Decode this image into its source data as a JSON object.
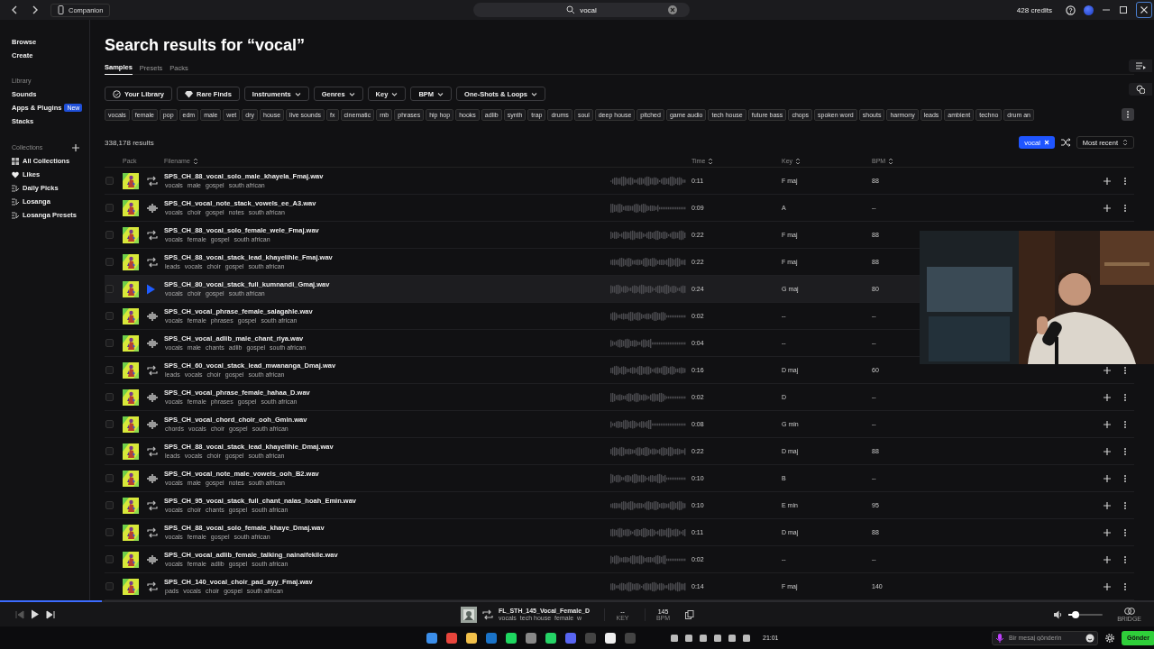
{
  "title_bar": {
    "companion": "Companion",
    "search": {
      "value": "vocal"
    },
    "credits": "428 credits"
  },
  "sidebar": {
    "top_items": [
      {
        "label": "Browse",
        "selected": false
      },
      {
        "label": "Create",
        "selected": false
      }
    ],
    "library": {
      "title": "Library",
      "items": [
        {
          "label": "Sounds"
        },
        {
          "label": "Apps & Plugins",
          "badge": "New"
        },
        {
          "label": "Stacks"
        }
      ]
    },
    "collections": {
      "title": "Collections",
      "items": [
        {
          "label": "All Collections",
          "kind": "grid"
        },
        {
          "label": "Likes",
          "kind": "heart"
        },
        {
          "label": "Daily Picks",
          "kind": "stack"
        },
        {
          "label": "Losanga",
          "kind": "stack"
        },
        {
          "label": "Losanga Presets",
          "kind": "stack"
        }
      ]
    }
  },
  "heading": "Search results for “vocal”",
  "tabs": [
    {
      "label": "Samples",
      "selected": true
    },
    {
      "label": "Presets",
      "selected": false
    },
    {
      "label": "Packs",
      "selected": false
    }
  ],
  "filters": [
    {
      "label": "Your Library",
      "kind": "check"
    },
    {
      "label": "Rare Finds",
      "kind": "diamond"
    },
    {
      "label": "Instruments",
      "kind": "dropdown"
    },
    {
      "label": "Genres",
      "kind": "dropdown"
    },
    {
      "label": "Key",
      "kind": "dropdown"
    },
    {
      "label": "BPM",
      "kind": "dropdown"
    },
    {
      "label": "One-Shots & Loops",
      "kind": "dropdown"
    }
  ],
  "tags": [
    "vocals",
    "female",
    "pop",
    "edm",
    "male",
    "wet",
    "dry",
    "house",
    "live sounds",
    "fx",
    "cinematic",
    "rnb",
    "phrases",
    "hip hop",
    "hooks",
    "adlib",
    "synth",
    "trap",
    "drums",
    "soul",
    "deep house",
    "pitched",
    "game audio",
    "tech house",
    "future bass",
    "chops",
    "spoken word",
    "shouts",
    "harmony",
    "leads",
    "ambient",
    "techno",
    "drum an"
  ],
  "results_count": "338,178 results",
  "active_filter": "vocal",
  "sort": "Most recent",
  "columns": [
    {
      "label": "Pack",
      "sortable": false
    },
    {
      "label": "Filename",
      "sortable": true
    },
    {
      "label": "Time",
      "sortable": true
    },
    {
      "label": "Key",
      "sortable": true
    },
    {
      "label": "BPM",
      "sortable": true
    }
  ],
  "rows": [
    {
      "name": "SPS_CH_88_vocal_solo_male_khayela_Fmaj.wav",
      "tags": [
        "vocals",
        "male",
        "gospel",
        "south african"
      ],
      "time": "0:11",
      "key": "F maj",
      "bpm": "88",
      "kind": "loop",
      "checked": false,
      "playing": false,
      "covered": false
    },
    {
      "name": "SPS_CH_vocal_note_stack_vowels_ee_A3.wav",
      "tags": [
        "vocals",
        "choir",
        "gospel",
        "notes",
        "south african"
      ],
      "time": "0:09",
      "key": "A",
      "bpm": "--",
      "kind": "oneshot",
      "checked": false,
      "playing": false,
      "covered": false
    },
    {
      "name": "SPS_CH_88_vocal_solo_female_wele_Fmaj.wav",
      "tags": [
        "vocals",
        "female",
        "gospel",
        "south african"
      ],
      "time": "0:22",
      "key": "F maj",
      "bpm": "88",
      "kind": "loop",
      "checked": false,
      "playing": false,
      "covered": true
    },
    {
      "name": "SPS_CH_88_vocal_stack_lead_khayelihle_Fmaj.wav",
      "tags": [
        "leads",
        "vocals",
        "choir",
        "gospel",
        "south african"
      ],
      "time": "0:22",
      "key": "F maj",
      "bpm": "88",
      "kind": "loop",
      "checked": false,
      "playing": false,
      "covered": true
    },
    {
      "name": "SPS_CH_80_vocal_stack_full_kumnandi_Gmaj.wav",
      "tags": [
        "vocals",
        "choir",
        "gospel",
        "south african"
      ],
      "time": "0:24",
      "key": "G maj",
      "bpm": "80",
      "kind": "loop",
      "checked": false,
      "playing": true,
      "covered": true
    },
    {
      "name": "SPS_CH_vocal_phrase_female_salagahle.wav",
      "tags": [
        "vocals",
        "female",
        "phrases",
        "gospel",
        "south african"
      ],
      "time": "0:02",
      "key": "--",
      "bpm": "--",
      "kind": "oneshot",
      "checked": false,
      "playing": false,
      "covered": true
    },
    {
      "name": "SPS_CH_vocal_adlib_male_chant_riya.wav",
      "tags": [
        "vocals",
        "male",
        "chants",
        "adlib",
        "gospel",
        "south african"
      ],
      "time": "0:04",
      "key": "--",
      "bpm": "--",
      "kind": "oneshot",
      "checked": false,
      "playing": false,
      "covered": true
    },
    {
      "name": "SPS_CH_60_vocal_stack_lead_mwananga_Dmaj.wav",
      "tags": [
        "leads",
        "vocals",
        "choir",
        "gospel",
        "south african"
      ],
      "time": "0:16",
      "key": "D maj",
      "bpm": "60",
      "kind": "loop",
      "checked": false,
      "playing": false,
      "covered": false
    },
    {
      "name": "SPS_CH_vocal_phrase_female_hahaa_D.wav",
      "tags": [
        "vocals",
        "female",
        "phrases",
        "gospel",
        "south african"
      ],
      "time": "0:02",
      "key": "D",
      "bpm": "--",
      "kind": "oneshot",
      "checked": false,
      "playing": false,
      "covered": false
    },
    {
      "name": "SPS_CH_vocal_chord_choir_ooh_Gmin.wav",
      "tags": [
        "chords",
        "vocals",
        "choir",
        "gospel",
        "south african"
      ],
      "time": "0:08",
      "key": "G min",
      "bpm": "--",
      "kind": "oneshot",
      "checked": false,
      "playing": false,
      "covered": false
    },
    {
      "name": "SPS_CH_88_vocal_stack_lead_khayelihle_Dmaj.wav",
      "tags": [
        "leads",
        "vocals",
        "choir",
        "gospel",
        "south african"
      ],
      "time": "0:22",
      "key": "D maj",
      "bpm": "88",
      "kind": "loop",
      "checked": false,
      "playing": false,
      "covered": false
    },
    {
      "name": "SPS_CH_vocal_note_male_vowels_ooh_B2.wav",
      "tags": [
        "vocals",
        "male",
        "gospel",
        "notes",
        "south african"
      ],
      "time": "0:10",
      "key": "B",
      "bpm": "--",
      "kind": "oneshot",
      "checked": false,
      "playing": false,
      "covered": false
    },
    {
      "name": "SPS_CH_95_vocal_stack_full_chant_nalas_hoah_Emin.wav",
      "tags": [
        "vocals",
        "choir",
        "chants",
        "gospel",
        "south african"
      ],
      "time": "0:10",
      "key": "E min",
      "bpm": "95",
      "kind": "loop",
      "checked": false,
      "playing": false,
      "covered": false
    },
    {
      "name": "SPS_CH_88_vocal_solo_female_khaye_Dmaj.wav",
      "tags": [
        "vocals",
        "female",
        "gospel",
        "south african"
      ],
      "time": "0:11",
      "key": "D maj",
      "bpm": "88",
      "kind": "loop",
      "checked": false,
      "playing": false,
      "covered": false
    },
    {
      "name": "SPS_CH_vocal_adlib_female_talking_nainaifekile.wav",
      "tags": [
        "vocals",
        "female",
        "adlib",
        "gospel",
        "south african"
      ],
      "time": "0:02",
      "key": "--",
      "bpm": "--",
      "kind": "oneshot",
      "checked": false,
      "playing": false,
      "covered": false
    },
    {
      "name": "SPS_CH_140_vocal_choir_pad_ayy_Fmaj.wav",
      "tags": [
        "pads",
        "vocals",
        "choir",
        "gospel",
        "south african"
      ],
      "time": "0:14",
      "key": "F maj",
      "bpm": "140",
      "kind": "loop",
      "checked": false,
      "playing": false,
      "covered": false
    }
  ],
  "player": {
    "progress": {
      "level": 0.088
    },
    "title": "FL_STH_145_Vocal_Female_D",
    "tags": [
      "vocals",
      "tech house",
      "female",
      "w"
    ],
    "key": "--",
    "key_label": "KEY",
    "bpm": "145",
    "bpm_label": "BPM",
    "volume": {
      "level": 0.2
    },
    "bridge_label": "BRIDGE"
  },
  "taskbar": {
    "time": "21:01",
    "chat": {
      "placeholder": "Bir mesaj gönderin"
    },
    "send": "Gönder"
  }
}
